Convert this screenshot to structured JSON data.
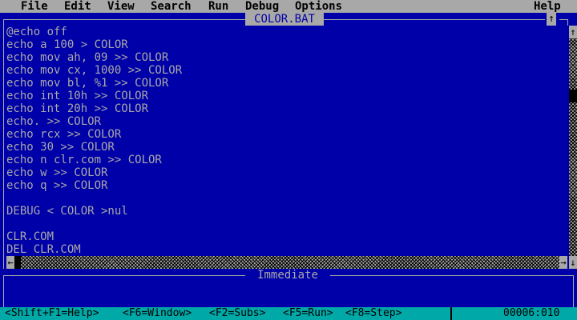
{
  "menu": {
    "items": [
      "File",
      "Edit",
      "View",
      "Search",
      "Run",
      "Debug",
      "Options"
    ],
    "help": "Help"
  },
  "editor": {
    "title": "COLOR.BAT",
    "maximize_glyph": "↑",
    "lines": [
      "@echo off",
      "echo a 100 > COLOR",
      "echo mov ah, 09 >> COLOR",
      "echo mov cx, 1000 >> COLOR",
      "echo mov bl, %1 >> COLOR",
      "echo int 10h >> COLOR",
      "echo int 20h >> COLOR",
      "echo. >> COLOR",
      "echo rcx >> COLOR",
      "echo 30 >> COLOR",
      "echo n clr.com >> COLOR",
      "echo w >> COLOR",
      "echo q >> COLOR",
      "",
      "DEBUG < COLOR >nul",
      "",
      "CLR.COM",
      "DEL CLR.COM"
    ]
  },
  "scrollbars": {
    "up_arrow": "↑",
    "down_arrow": "↓",
    "left_arrow": "←",
    "right_arrow": "→"
  },
  "immediate": {
    "title": "Immediate"
  },
  "statusbar": {
    "shortcuts": [
      "<Shift+F1=Help>",
      "<F6=Window>",
      "<F2=Subs>",
      "<F5=Run>",
      "<F8=Step>"
    ],
    "position": "00006:010"
  },
  "colors": {
    "background": "#0000a8",
    "menu_bar": "#a8a8a8",
    "text": "#a8a8a8",
    "status_bar": "#00a8a8"
  }
}
